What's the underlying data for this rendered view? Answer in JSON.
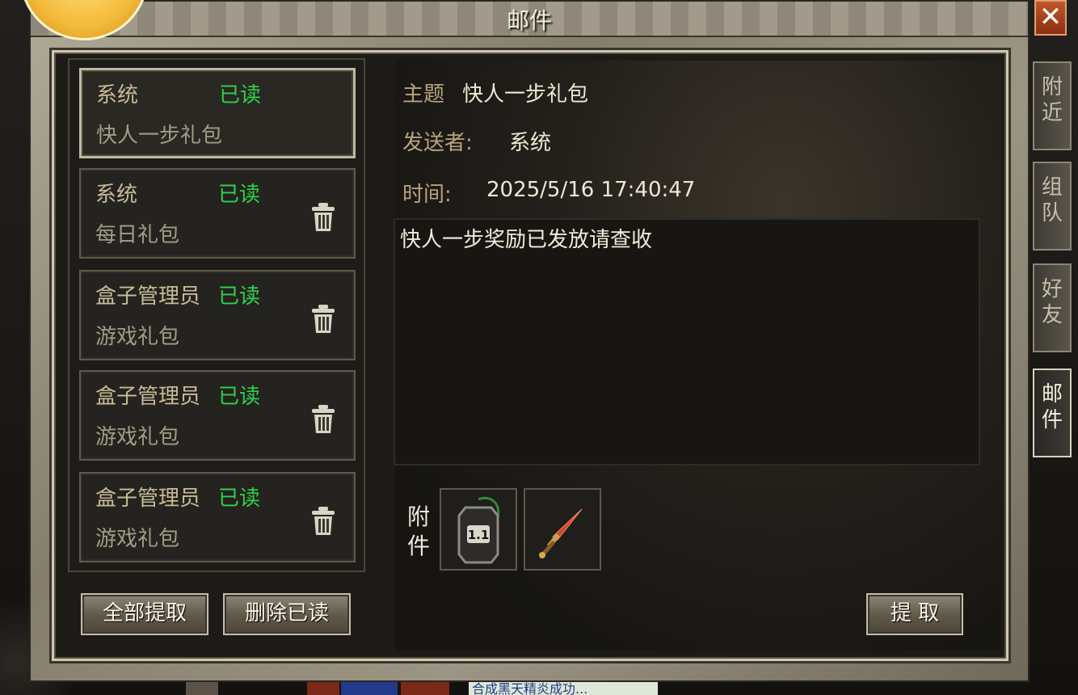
{
  "window": {
    "title": "邮件",
    "close_glyph": "✕"
  },
  "side_tabs": [
    {
      "label": [
        "附",
        "近"
      ],
      "active": false
    },
    {
      "label": [
        "组",
        "队"
      ],
      "active": false
    },
    {
      "label": [
        "好",
        "友"
      ],
      "active": false
    },
    {
      "label": [
        "邮",
        "件"
      ],
      "active": true
    }
  ],
  "mails": [
    {
      "sender": "系统",
      "status": "已读",
      "title": "快人一步礼包",
      "selected": true,
      "deletable": false
    },
    {
      "sender": "系统",
      "status": "已读",
      "title": "每日礼包",
      "selected": false,
      "deletable": true
    },
    {
      "sender": "盒子管理员",
      "status": "已读",
      "title": "游戏礼包",
      "selected": false,
      "deletable": true
    },
    {
      "sender": "盒子管理员",
      "status": "已读",
      "title": "游戏礼包",
      "selected": false,
      "deletable": true
    },
    {
      "sender": "盒子管理员",
      "status": "已读",
      "title": "游戏礼包",
      "selected": false,
      "deletable": true
    }
  ],
  "list_buttons": {
    "collect_all": "全部提取",
    "delete_read": "删除已读"
  },
  "detail": {
    "subject_label": "主题",
    "subject_value": "快人一步礼包",
    "sender_label": "发送者:",
    "sender_value": "系统",
    "time_label": "时间:",
    "time_value": "2025/5/16 17:40:47",
    "body": "快人一步奖励已发放请查收",
    "attachment_label": "附件",
    "attachments": [
      {
        "icon": "tag-1.1-icon",
        "badge": "1.1"
      },
      {
        "icon": "sword-icon"
      }
    ],
    "claim_button": "提 取"
  },
  "status_color": "#2fd14b",
  "bottom_ticker": "合成黑天精炎成功..."
}
